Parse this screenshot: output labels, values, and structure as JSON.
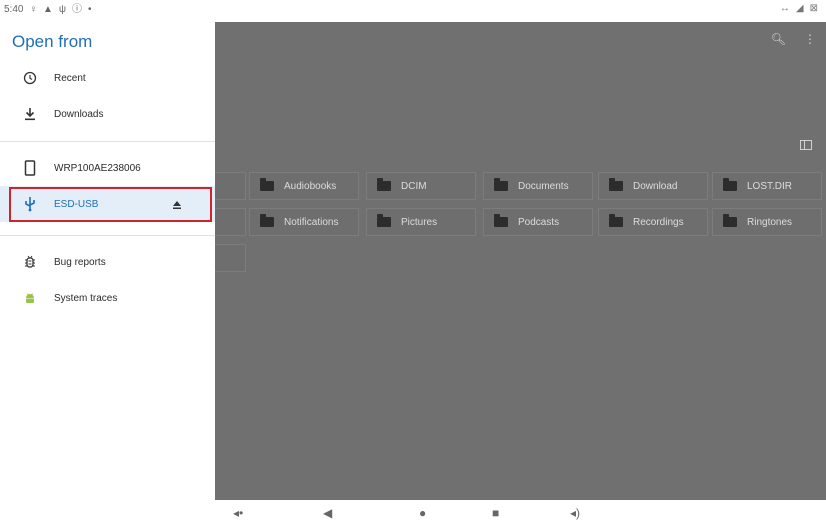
{
  "status_bar": {
    "time": "5:40",
    "left_icons": [
      "notification-icon",
      "alarm-icon",
      "usb-icon",
      "info-icon",
      "dot-icon"
    ],
    "right_icons": [
      "vibrate-icon",
      "battery-icon",
      "wifi-off-icon"
    ]
  },
  "drawer": {
    "title": "Open from",
    "items": [
      {
        "label": "Recent",
        "icon": "clock-icon"
      },
      {
        "label": "Downloads",
        "icon": "download-icon"
      },
      {
        "label": "WRP100AE238006",
        "icon": "device-icon"
      },
      {
        "label": "ESD-USB",
        "icon": "usb-icon",
        "selected": true
      },
      {
        "label": "Bug reports",
        "icon": "bug-icon"
      },
      {
        "label": "System traces",
        "icon": "android-icon"
      }
    ]
  },
  "content": {
    "folders_row1": [
      "Audiobooks",
      "DCIM",
      "Documents",
      "Download",
      "LOST.DIR"
    ],
    "folders_row2": [
      "Notifications",
      "Pictures",
      "Podcasts",
      "Recordings",
      "Ringtones"
    ]
  },
  "colors": {
    "accent": "#1f6fb8",
    "highlight": "#d1232a",
    "scrim": "#707070"
  }
}
